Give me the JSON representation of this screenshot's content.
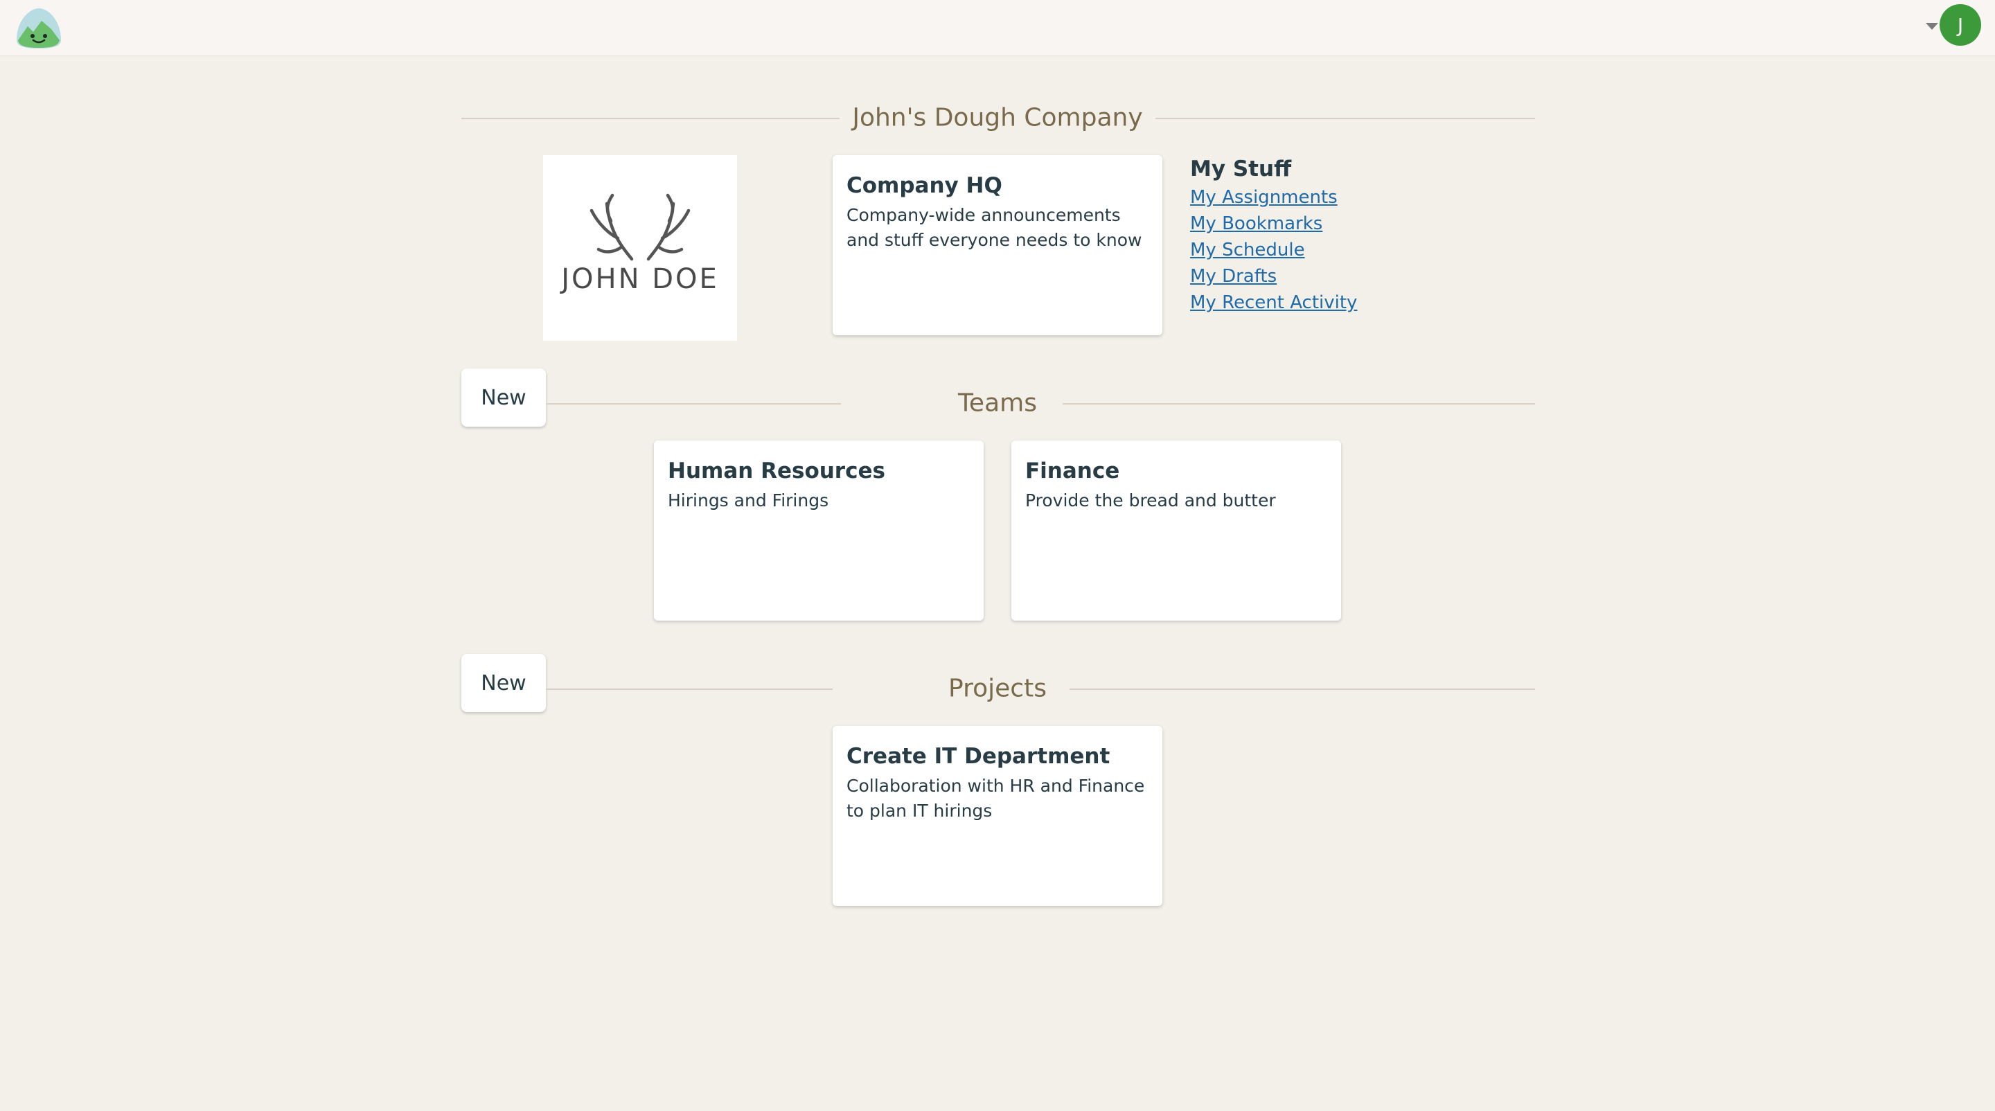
{
  "topbar": {
    "logo_icon": "basecamp-mountain-logo",
    "avatar_initial": "J",
    "avatar_color": "#3c9a3a"
  },
  "company": {
    "name": "John's Dough Company",
    "logo_text": "JOHN DOE"
  },
  "hq_card": {
    "title": "Company HQ",
    "description": "Company-wide announcements and stuff everyone needs to know"
  },
  "mystuff": {
    "title": "My Stuff",
    "links": [
      "My Assignments",
      "My Bookmarks",
      "My Schedule",
      "My Drafts",
      "My Recent Activity"
    ]
  },
  "teams": {
    "heading": "Teams",
    "new_label": "New",
    "items": [
      {
        "title": "Human Resources",
        "description": "Hirings and Firings"
      },
      {
        "title": "Finance",
        "description": "Provide the bread and butter"
      }
    ]
  },
  "projects": {
    "heading": "Projects",
    "new_label": "New",
    "items": [
      {
        "title": "Create IT Department",
        "description": "Collaboration with HR and Finance to plan IT hirings"
      }
    ]
  }
}
